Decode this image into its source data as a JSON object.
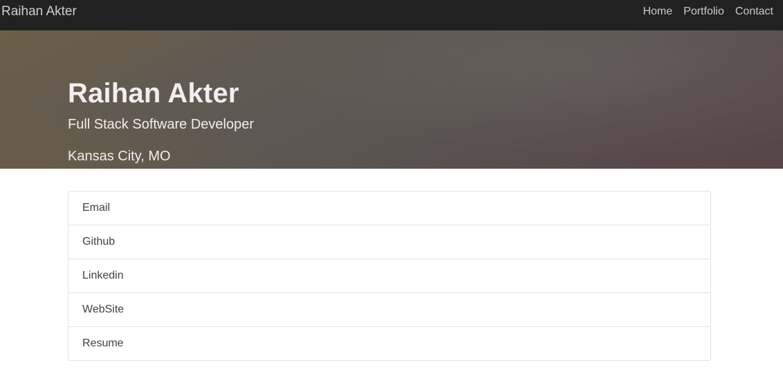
{
  "navbar": {
    "brand": "Raihan Akter",
    "links": [
      "Home",
      "Portfolio",
      "Contact"
    ]
  },
  "hero": {
    "title": "Raihan Akter",
    "subtitle": "Full Stack Software Developer",
    "location": "Kansas City, MO"
  },
  "contact_list": {
    "items": [
      "Email",
      "Github",
      "Linkedin",
      "WebSite",
      "Resume"
    ]
  },
  "colors": {
    "navbar_bg": "#212121",
    "hero_gradient_start": "#6b5f48",
    "hero_gradient_end": "#574547",
    "list_border": "#dee2e6"
  }
}
